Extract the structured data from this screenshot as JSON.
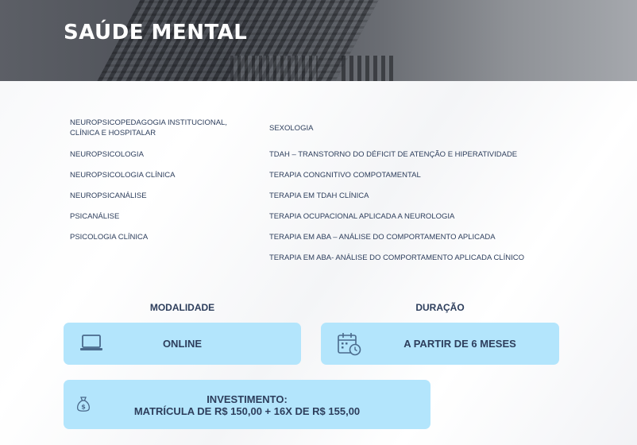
{
  "hero": {
    "title": "SAÚDE MENTAL"
  },
  "courses": {
    "left": [
      "NEUROPSICOPEDAGOGIA INSTITUCIONAL, CLÍNICA E HOSPITALAR",
      "NEUROPSICOLOGIA",
      "NEUROPSICOLOGIA CLÍNICA",
      "NEUROPSICANÁLISE",
      "PSICANÁLISE",
      "PSICOLOGIA CLÍNICA"
    ],
    "right": [
      "SEXOLOGIA",
      "TDAH – TRANSTORNO DO DÉFICIT DE ATENÇÃO E HIPERATIVIDADE",
      "TERAPIA CONGNITIVO COMPOTAMENTAL",
      "TERAPIA EM TDAH CLÍNICA",
      "TERAPIA OCUPACIONAL APLICADA A NEUROLOGIA",
      "TERAPIA EM ABA – ANÁLISE DO COMPORTAMENTO APLICADA",
      "TERAPIA EM ABA- ANÁLISE DO COMPORTAMENTO APLICADA CLÍNICO"
    ]
  },
  "modalidade": {
    "label": "MODALIDADE",
    "value": "ONLINE",
    "icon": "laptop-icon"
  },
  "duracao": {
    "label": "DURAÇÃO",
    "value": "A PARTIR DE 6 MESES",
    "icon": "calendar-clock-icon"
  },
  "investimento": {
    "line1": "INVESTIMENTO:",
    "line2": "MATRÍCULA DE R$ 150,00 + 16X DE R$ 155,00",
    "icon": "money-bag-icon"
  },
  "colors": {
    "card_bg": "#b3e5fc",
    "text": "#2d3e5c",
    "icon": "#4a6a8c"
  }
}
